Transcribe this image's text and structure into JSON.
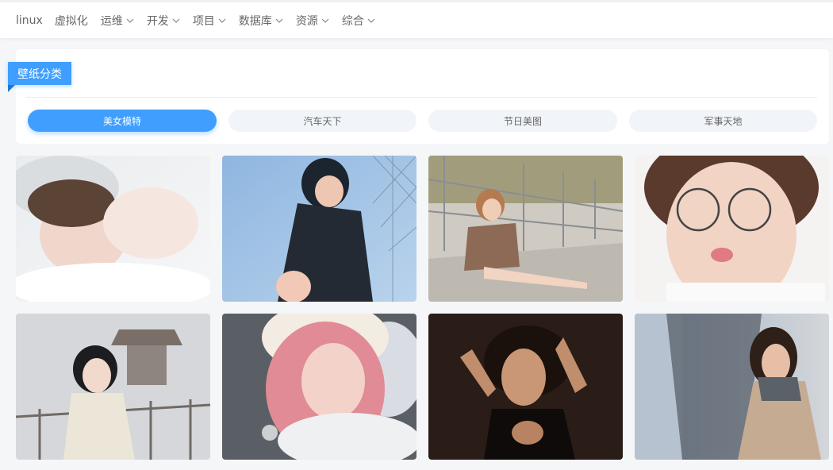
{
  "nav": {
    "items": [
      {
        "label": "linux",
        "has_dropdown": false
      },
      {
        "label": "虚拟化",
        "has_dropdown": false
      },
      {
        "label": "运维",
        "has_dropdown": true
      },
      {
        "label": "开发",
        "has_dropdown": true
      },
      {
        "label": "项目",
        "has_dropdown": true
      },
      {
        "label": "数据库",
        "has_dropdown": true
      },
      {
        "label": "资源",
        "has_dropdown": true
      },
      {
        "label": "综合",
        "has_dropdown": true
      }
    ]
  },
  "category_panel": {
    "title": "壁纸分类",
    "categories": [
      {
        "label": "美女模特",
        "active": true
      },
      {
        "label": "汽车天下",
        "active": false
      },
      {
        "label": "节日美图",
        "active": false
      },
      {
        "label": "军事天地",
        "active": false
      }
    ]
  },
  "colors": {
    "accent": "#409eff",
    "idle_chip": "#f1f4f9",
    "page_bg": "#f5f6f8"
  },
  "photos": [
    {
      "name": "wallpaper-1"
    },
    {
      "name": "wallpaper-2"
    },
    {
      "name": "wallpaper-3"
    },
    {
      "name": "wallpaper-4"
    },
    {
      "name": "wallpaper-5"
    },
    {
      "name": "wallpaper-6"
    },
    {
      "name": "wallpaper-7"
    },
    {
      "name": "wallpaper-8"
    }
  ]
}
